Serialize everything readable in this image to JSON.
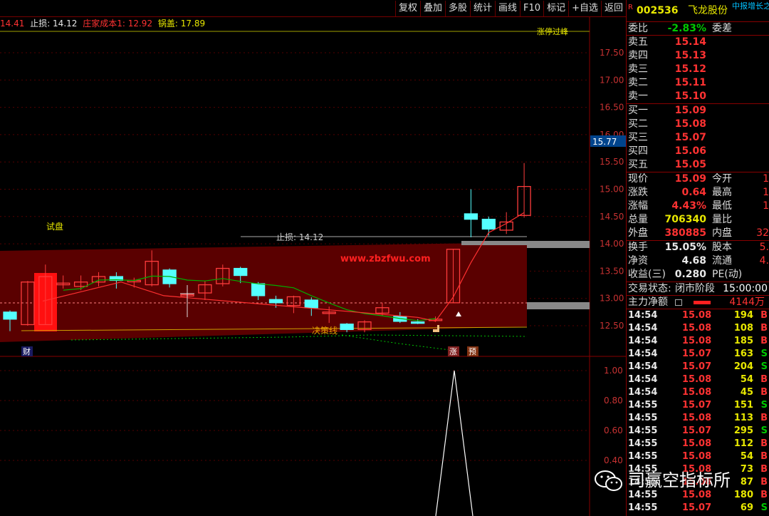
{
  "toolbar": {
    "buttons": [
      "复权",
      "叠加",
      "多股",
      "统计",
      "画线",
      "F10",
      "标记",
      "+自选",
      "返回"
    ]
  },
  "legend": {
    "first": "14.41",
    "stop_loss": "止损: 14.12",
    "dealer_cost": "庄家成本1: 12.92",
    "lid": "锅盖: 17.89"
  },
  "price_axis": {
    "ticks": [
      "17.50",
      "17.00",
      "16.50",
      "16.00",
      "15.50",
      "15.00",
      "14.50",
      "14.00",
      "13.50",
      "13.00",
      "12.50"
    ],
    "current_label": "15.77",
    "lower_ticks": [
      "1.00",
      "0.80",
      "0.60",
      "0.40"
    ]
  },
  "annotations": {
    "trial": "试盘",
    "stop_line": "止损: 14.12",
    "decision_line": "决策线",
    "website": "www.zbzfwu.com",
    "top_label": "涨停过峰",
    "cai": "财",
    "zhang": "涨",
    "yu": "预"
  },
  "candles": [
    {
      "o": 12.75,
      "c": 12.62,
      "h": 12.78,
      "l": 12.4
    },
    {
      "o": 12.52,
      "c": 13.3,
      "h": 13.32,
      "l": 12.5
    },
    {
      "o": 12.52,
      "c": 13.4,
      "h": 13.62,
      "l": 12.52
    },
    {
      "o": 13.25,
      "c": 13.28,
      "h": 13.42,
      "l": 13.18
    },
    {
      "o": 13.22,
      "c": 13.3,
      "h": 13.42,
      "l": 13.15
    },
    {
      "o": 13.3,
      "c": 13.4,
      "h": 13.48,
      "l": 13.22
    },
    {
      "o": 13.4,
      "c": 13.33,
      "h": 13.48,
      "l": 13.18
    },
    {
      "o": 13.33,
      "c": 13.33,
      "h": 13.38,
      "l": 13.2
    },
    {
      "o": 13.25,
      "c": 13.68,
      "h": 13.88,
      "l": 13.22
    },
    {
      "o": 13.52,
      "c": 13.27,
      "h": 13.55,
      "l": 13.2
    },
    {
      "o": 13.07,
      "c": 13.07,
      "h": 13.2,
      "l": 12.83
    },
    {
      "o": 13.1,
      "c": 13.25,
      "h": 13.32,
      "l": 12.97
    },
    {
      "o": 13.27,
      "c": 13.55,
      "h": 13.62,
      "l": 13.22
    },
    {
      "o": 13.55,
      "c": 13.42,
      "h": 13.58,
      "l": 13.28
    },
    {
      "o": 13.27,
      "c": 13.05,
      "h": 13.3,
      "l": 12.97
    },
    {
      "o": 12.98,
      "c": 12.92,
      "h": 13.05,
      "l": 12.83
    },
    {
      "o": 12.87,
      "c": 13.03,
      "h": 13.05,
      "l": 12.73
    },
    {
      "o": 12.97,
      "c": 12.83,
      "h": 13.02,
      "l": 12.68
    },
    {
      "o": 12.75,
      "c": 12.75,
      "h": 12.85,
      "l": 12.55
    },
    {
      "o": 12.53,
      "c": 12.43,
      "h": 12.55,
      "l": 12.38
    },
    {
      "o": 12.43,
      "c": 12.57,
      "h": 12.6,
      "l": 12.38
    },
    {
      "o": 12.73,
      "c": 12.83,
      "h": 12.92,
      "l": 12.68
    },
    {
      "o": 12.67,
      "c": 12.58,
      "h": 12.75,
      "l": 12.55
    },
    {
      "o": 12.57,
      "c": 12.55,
      "h": 12.62,
      "l": 12.53
    },
    {
      "o": 12.6,
      "c": 12.62,
      "h": 12.67,
      "l": 12.57
    },
    {
      "o": 12.92,
      "c": 13.9,
      "h": 13.9,
      "l": 12.92
    },
    {
      "o": 14.55,
      "c": 14.45,
      "h": 15.0,
      "l": 14.12
    },
    {
      "o": 14.45,
      "c": 14.27,
      "h": 14.5,
      "l": 14.15
    },
    {
      "o": 14.25,
      "c": 14.4,
      "h": 14.58,
      "l": 14.18
    },
    {
      "o": 14.52,
      "c": 15.05,
      "h": 15.48,
      "l": 14.48
    }
  ],
  "stock": {
    "code": "002536",
    "name": "飞龙股份",
    "tag": "中报增长之",
    "flag": "R"
  },
  "quote": {
    "weibi_label": "委比",
    "weibi": "-2.83%",
    "weicha_label": "委差",
    "sell": [
      {
        "label": "卖五",
        "price": "15.14"
      },
      {
        "label": "卖四",
        "price": "15.13"
      },
      {
        "label": "卖三",
        "price": "15.12"
      },
      {
        "label": "卖二",
        "price": "15.11"
      },
      {
        "label": "卖一",
        "price": "15.10"
      }
    ],
    "buy": [
      {
        "label": "买一",
        "price": "15.09"
      },
      {
        "label": "买二",
        "price": "15.08"
      },
      {
        "label": "买三",
        "price": "15.07"
      },
      {
        "label": "买四",
        "price": "15.06"
      },
      {
        "label": "买五",
        "price": "15.05"
      }
    ],
    "stats": [
      {
        "l": "现价",
        "v": "15.09",
        "l2": "今开",
        "v2": "1"
      },
      {
        "l": "涨跌",
        "v": "0.64",
        "l2": "最高",
        "v2": "1"
      },
      {
        "l": "涨幅",
        "v": "4.43%",
        "l2": "最低",
        "v2": "1"
      },
      {
        "l": "总量",
        "v": "706340",
        "l2": "量比",
        "v2": ""
      },
      {
        "l": "外盘",
        "v": "380885",
        "l2": "内盘",
        "v2": "32"
      }
    ],
    "stats2": [
      {
        "l": "换手",
        "v": "15.05%",
        "l2": "股本",
        "v2": "5."
      },
      {
        "l": "净资",
        "v": "4.68",
        "l2": "流通",
        "v2": "4."
      },
      {
        "l": "收益(三)",
        "v": "0.280",
        "l2": "PE(动)",
        "v2": ""
      }
    ],
    "trade_status_label": "交易状态:",
    "trade_status": "闭市阶段",
    "trade_time": "15:00:00",
    "main_net_label": "主力净额",
    "main_net": "4144万"
  },
  "trades": [
    {
      "t": "14:54",
      "p": "15.08",
      "v": "194",
      "s": "B"
    },
    {
      "t": "14:54",
      "p": "15.08",
      "v": "108",
      "s": "B"
    },
    {
      "t": "14:54",
      "p": "15.08",
      "v": "185",
      "s": "B"
    },
    {
      "t": "14:54",
      "p": "15.07",
      "v": "163",
      "s": "S"
    },
    {
      "t": "14:54",
      "p": "15.07",
      "v": "204",
      "s": "S"
    },
    {
      "t": "14:54",
      "p": "15.08",
      "v": "54",
      "s": "B"
    },
    {
      "t": "14:54",
      "p": "15.08",
      "v": "45",
      "s": "B"
    },
    {
      "t": "14:55",
      "p": "15.07",
      "v": "151",
      "s": "S"
    },
    {
      "t": "14:55",
      "p": "15.08",
      "v": "113",
      "s": "B"
    },
    {
      "t": "14:55",
      "p": "15.07",
      "v": "295",
      "s": "S"
    },
    {
      "t": "14:55",
      "p": "15.08",
      "v": "112",
      "s": "B"
    },
    {
      "t": "14:55",
      "p": "15.08",
      "v": "54",
      "s": "B"
    },
    {
      "t": "14:55",
      "p": "15.08",
      "v": "73",
      "s": "B"
    },
    {
      "t": "14:55",
      "p": "15.08",
      "v": "87",
      "s": "B"
    },
    {
      "t": "14:55",
      "p": "15.08",
      "v": "180",
      "s": "B"
    },
    {
      "t": "14:55",
      "p": "15.07",
      "v": "69",
      "s": "S"
    }
  ],
  "watermark": "司赢空指标所",
  "colors": {
    "up": "#ff3c3c",
    "down": "#54ffff",
    "band": "#5a0000",
    "ma": "#e8e8e8"
  }
}
